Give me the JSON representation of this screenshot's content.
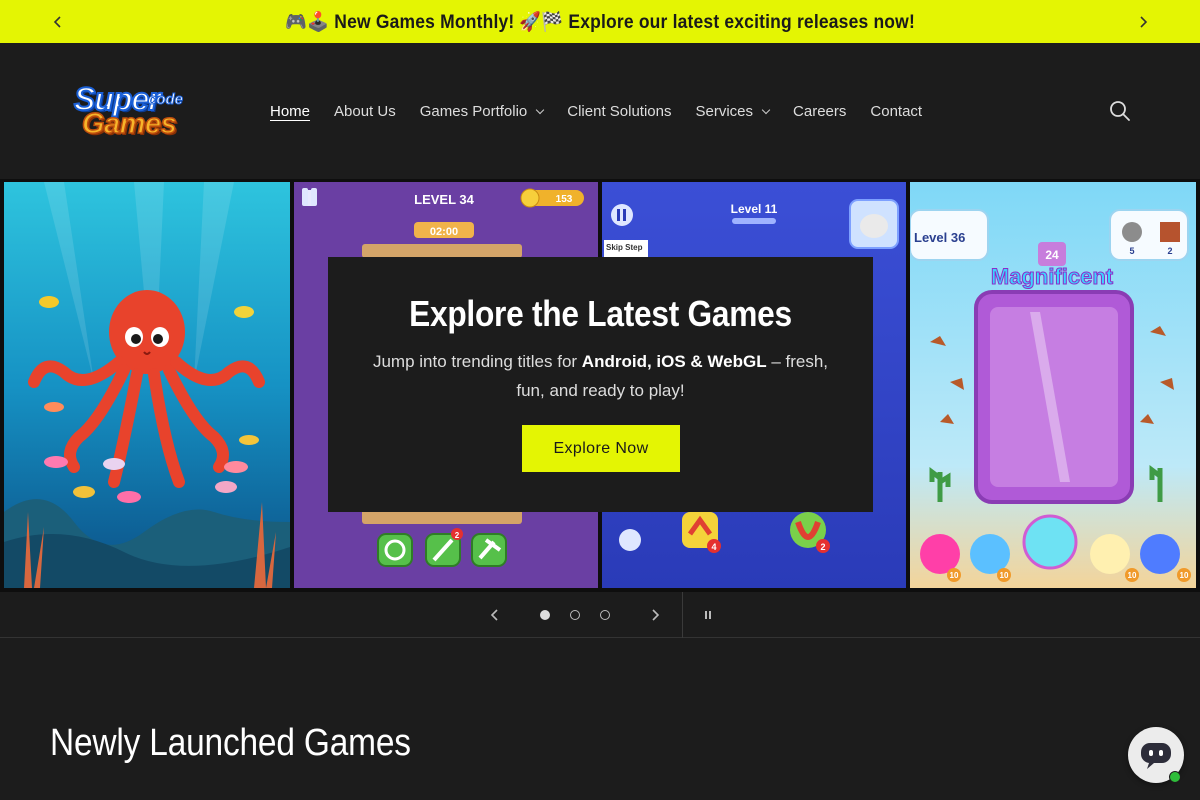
{
  "announcement": {
    "text": "🎮🕹️ New Games Monthly! 🚀🏁 Explore our latest exciting releases now!",
    "prev_icon": "chevron-left-icon",
    "next_icon": "chevron-right-icon"
  },
  "header": {
    "logo": {
      "word1": "Super",
      "word1_small": "code",
      "word2": "Games"
    },
    "nav": [
      {
        "label": "Home",
        "active": true,
        "has_dropdown": false
      },
      {
        "label": "About Us",
        "active": false,
        "has_dropdown": false
      },
      {
        "label": "Games Portfolio",
        "active": false,
        "has_dropdown": true
      },
      {
        "label": "Client Solutions",
        "active": false,
        "has_dropdown": false
      },
      {
        "label": "Services",
        "active": false,
        "has_dropdown": true
      },
      {
        "label": "Careers",
        "active": false,
        "has_dropdown": false
      },
      {
        "label": "Contact",
        "active": false,
        "has_dropdown": false
      }
    ],
    "search_icon": "search-icon"
  },
  "hero": {
    "panels": [
      {
        "name": "octopus-game-screenshot"
      },
      {
        "name": "level-34-game-screenshot",
        "level": "LEVEL 34",
        "timer": "02:00",
        "coins": "153",
        "booster_badge": "2"
      },
      {
        "name": "level-11-game-screenshot",
        "level": "Level 11",
        "skip_label": "Skip Step",
        "badge_a": "4",
        "badge_b": "2"
      },
      {
        "name": "level-36-game-screenshot",
        "level": "Level 36",
        "ball_count": "24",
        "banner": "Magnificent",
        "counter_a": "5",
        "counter_b": "2",
        "booster_count": "10"
      }
    ],
    "card": {
      "title": "Explore the Latest Games",
      "subtitle_before": "Jump into trending titles for ",
      "subtitle_bold": "Android, iOS & WebGL",
      "subtitle_after": " – fresh, fun, and ready to play!",
      "button_label": "Explore Now"
    }
  },
  "slider": {
    "slide_count": 3,
    "active_index": 0
  },
  "section": {
    "title": "Newly Launched Games"
  },
  "chat": {
    "icon": "chat-bot-icon",
    "status": "online"
  },
  "colors": {
    "accent": "#e4f503",
    "background": "#1c1c1c",
    "online": "#2ebd3a"
  }
}
